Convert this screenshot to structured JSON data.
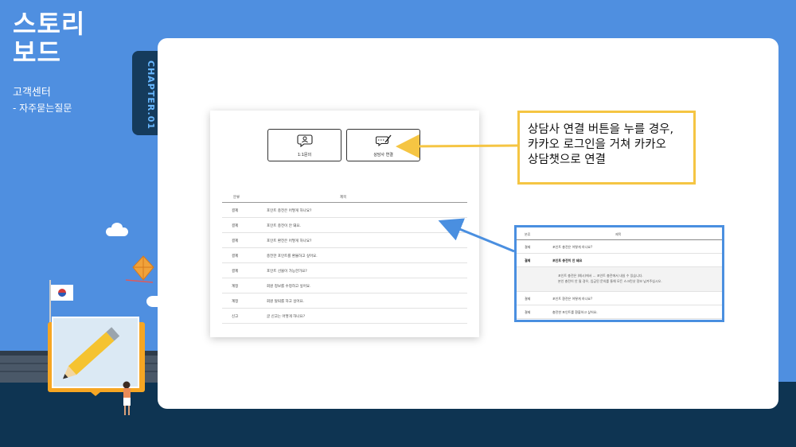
{
  "header": {
    "title_line1": "스토리",
    "title_line2": "보드",
    "section": "고객센터",
    "subsection": " - 자주묻는질문"
  },
  "chapter": {
    "label": "CHAPTER.01"
  },
  "mock_page": {
    "buttons": [
      {
        "label": "1:1문의",
        "icon": "chat-user-icon"
      },
      {
        "label": "상담사 연결",
        "icon": "chat-pen-icon"
      }
    ],
    "table": {
      "headers": [
        "분류",
        "제목"
      ],
      "rows": [
        {
          "category": "결제",
          "title": "포인트 충전은 어떻게 하나요?"
        },
        {
          "category": "결제",
          "title": "포인트 충전이 안 돼요."
        },
        {
          "category": "결제",
          "title": "포인트 환전은 어떻게 하나요?"
        },
        {
          "category": "결제",
          "title": "충전한 포인트를 환불하고 싶어요."
        },
        {
          "category": "결제",
          "title": "포인트 선물이 가능한가요?"
        },
        {
          "category": "계정",
          "title": "회원 정보를 수정하고 싶어요."
        },
        {
          "category": "계정",
          "title": "회원 탈퇴를 하고 싶어요."
        },
        {
          "category": "신고",
          "title": "글 신고는 어떻게 하나요?"
        }
      ]
    }
  },
  "callout": {
    "line1": "상담사 연결 버튼을 누를 경우,",
    "line2": "카카오 로그인을 거쳐 카카오",
    "line3": "상담챗으로 연결"
  },
  "detail_box": {
    "headers": [
      "분류",
      "제목"
    ],
    "rows": [
      {
        "category": "결제",
        "title": "포인트 충전은 어떻게 하나요?"
      },
      {
        "category": "결제",
        "title": "포인트 충전이 안 돼요"
      }
    ],
    "answer_line1": "포인트 충전은 (예시)에서 ... 포인트 충전에서 내실 수 있습니다.",
    "answer_line2": "본인 충전이 안 될 경우, 입금된 문의를 통해 모든 스크린샷 정보 남겨주십시오.",
    "rows_after": [
      {
        "category": "결제",
        "title": "포인트 환전은 어떻게 하나요?"
      },
      {
        "category": "결제",
        "title": "충전한 포인트를 환불하고 싶어요."
      }
    ]
  },
  "colors": {
    "sky": "#4f8fe0",
    "ground": "#0e3452",
    "callout_border": "#f5c543",
    "detail_border": "#4a8fe0",
    "chapter_text": "#67b7ff"
  }
}
